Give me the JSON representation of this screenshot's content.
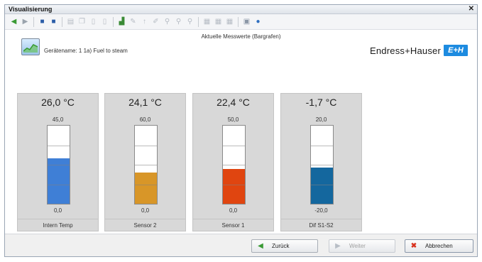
{
  "window": {
    "title": "Visualisierung"
  },
  "toolbar": {
    "items": [
      {
        "icon": "back-arrow-icon",
        "glyph": "◀",
        "color": "#3a9a35"
      },
      {
        "icon": "forward-arrow-icon",
        "glyph": "▶",
        "color": "#9aa3ad"
      },
      {
        "icon": "save-icon",
        "glyph": "■",
        "color": "#2c5ea8"
      },
      {
        "icon": "save-as-icon",
        "glyph": "■",
        "color": "#2c5ea8"
      },
      {
        "icon": "print-icon",
        "glyph": "▤",
        "color": "#b6bcc4"
      },
      {
        "icon": "copy-icon",
        "glyph": "❐",
        "color": "#b6bcc4"
      },
      {
        "icon": "page-icon",
        "glyph": "▯",
        "color": "#b6bcc4"
      },
      {
        "icon": "pages-icon",
        "glyph": "▯",
        "color": "#b6bcc4"
      },
      {
        "icon": "chart-icon",
        "glyph": "▟",
        "color": "#3a8a35"
      },
      {
        "icon": "edit-icon",
        "glyph": "✎",
        "color": "#b6bcc4"
      },
      {
        "icon": "pin-icon",
        "glyph": "↑",
        "color": "#b6bcc4"
      },
      {
        "icon": "marker-icon",
        "glyph": "✐",
        "color": "#b6bcc4"
      },
      {
        "icon": "zoom-in-icon",
        "glyph": "⚲",
        "color": "#b6bcc4"
      },
      {
        "icon": "zoom-out-icon",
        "glyph": "⚲",
        "color": "#b6bcc4"
      },
      {
        "icon": "zoom-reset-icon",
        "glyph": "⚲",
        "color": "#b6bcc4"
      },
      {
        "icon": "grid-icon",
        "glyph": "▦",
        "color": "#b6bcc4"
      },
      {
        "icon": "table-icon",
        "glyph": "▦",
        "color": "#b6bcc4"
      },
      {
        "icon": "list-icon",
        "glyph": "▦",
        "color": "#b6bcc4"
      },
      {
        "icon": "settings-icon",
        "glyph": "▣",
        "color": "#8a96a6"
      },
      {
        "icon": "help-icon",
        "glyph": "●",
        "color": "#2f6fc0"
      }
    ]
  },
  "header": {
    "title": "Aktuelle Messwerte (Bargrafen)",
    "device_name": "Gerätename: 1 1a) Fuel to steam",
    "brand": "Endress+Hauser",
    "logo_text": "E+H"
  },
  "channels": [
    {
      "value": "26,0 °C",
      "max": "45,0",
      "min": "0,0",
      "name": "Intern Temp",
      "fill_fraction": 0.58,
      "color": "#3f7fd6"
    },
    {
      "value": "24,1 °C",
      "max": "60,0",
      "min": "0,0",
      "name": "Sensor 2",
      "fill_fraction": 0.4,
      "color": "#d89628"
    },
    {
      "value": "22,4 °C",
      "max": "50,0",
      "min": "0,0",
      "name": "Sensor 1",
      "fill_fraction": 0.45,
      "color": "#e04510"
    },
    {
      "value": "-1,7 °C",
      "max": "20,0",
      "min": "-20,0",
      "name": "Dif S1-S2",
      "fill_fraction": 0.46,
      "color": "#14679e"
    }
  ],
  "footer": {
    "back_label": "Zurück",
    "next_label": "Weiter",
    "cancel_label": "Abbrechen"
  }
}
